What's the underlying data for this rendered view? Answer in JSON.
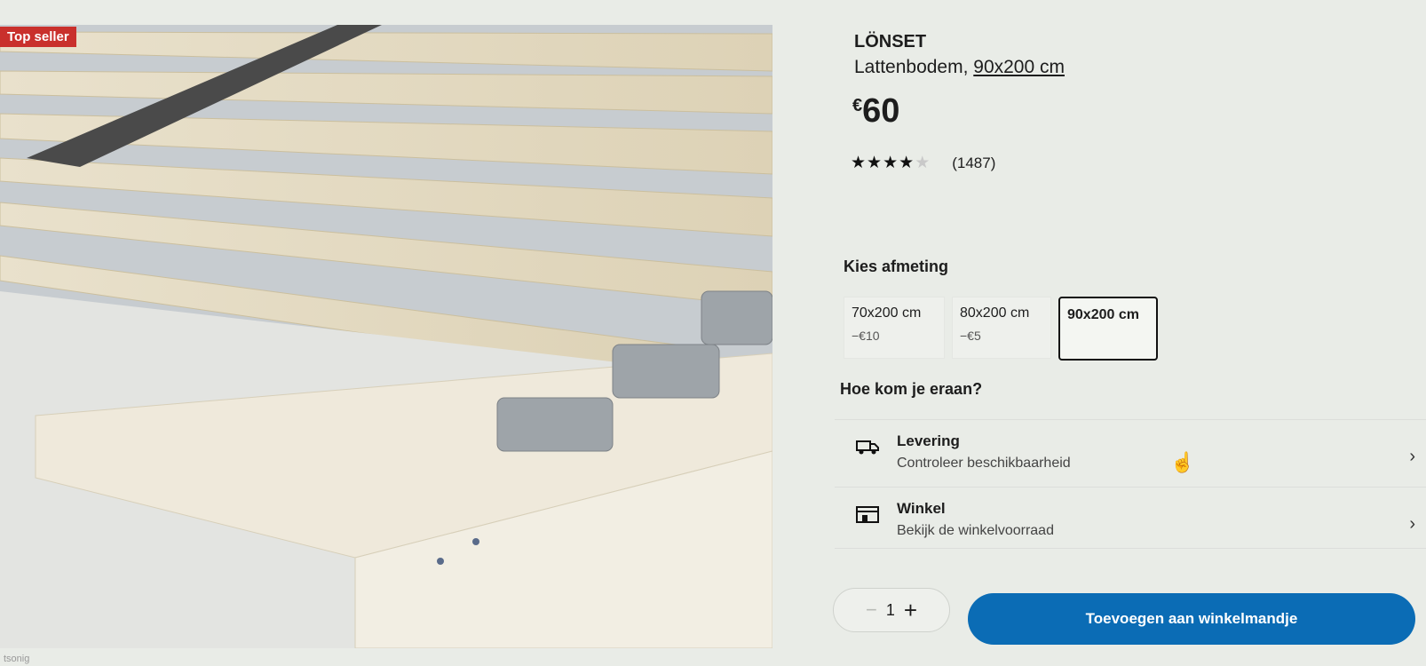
{
  "badge": "Top seller",
  "product": {
    "name": "LÖNSET",
    "description_prefix": "Lattenbodem, ",
    "size": "90x200 cm",
    "price_currency": "€",
    "price_value": "60",
    "rating_stars": 4,
    "rating_max": 5,
    "rating_count": "(1487)"
  },
  "size_selector": {
    "label": "Kies afmeting",
    "options": [
      {
        "label": "70x200 cm",
        "diff": "−€10"
      },
      {
        "label": "80x200 cm",
        "diff": "−€5"
      },
      {
        "label": "90x200 cm",
        "diff": ""
      }
    ],
    "selected": "90x200 cm"
  },
  "fulfillment": {
    "label": "Hoe kom je eraan?",
    "delivery": {
      "title": "Levering",
      "subtitle": "Controleer beschikbaarheid",
      "icon": "truck-icon"
    },
    "store": {
      "title": "Winkel",
      "subtitle": "Bekijk de winkelvoorraad",
      "icon": "store-icon"
    }
  },
  "cart": {
    "quantity": "1",
    "minus": "−",
    "plus": "+",
    "add_label": "Toevoegen aan winkelmandje",
    "button_color": "#0b6cb5"
  },
  "chevron": "›",
  "footer": "tsonig"
}
